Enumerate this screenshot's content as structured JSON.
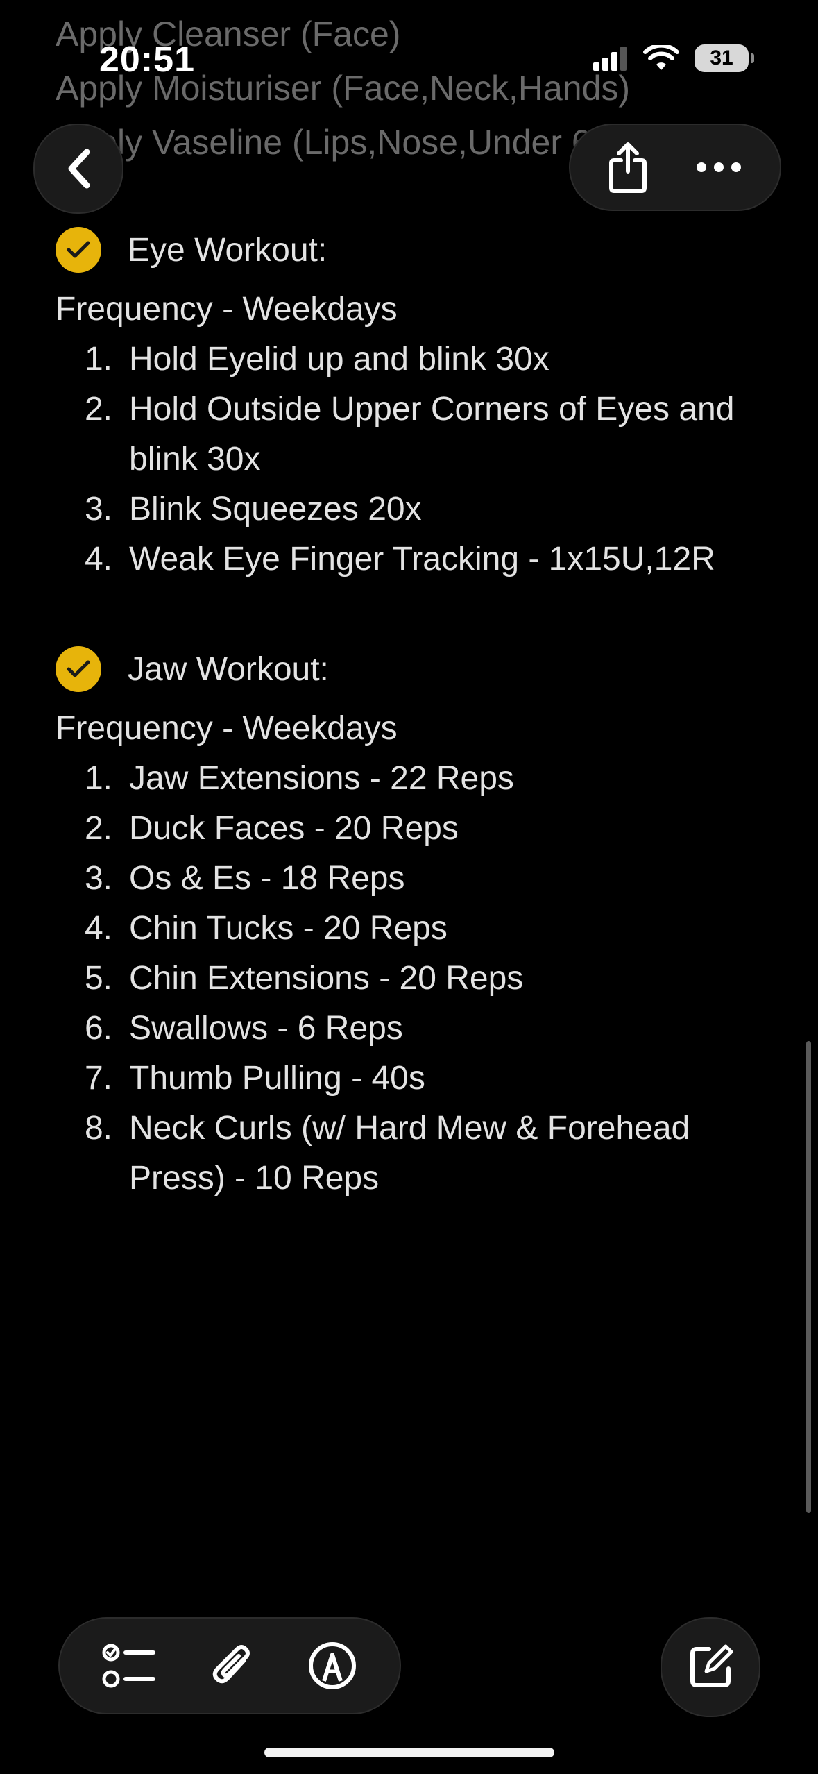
{
  "status_bar": {
    "time": "20:51",
    "battery": "31"
  },
  "faded_lines": [
    "Apply Cleanser (Face)",
    "Apply Moisturiser (Face,Neck,Hands)",
    "Apply Vaseline (Lips,Nose,Under 63)"
  ],
  "sections": [
    {
      "title": "Eye Workout:",
      "frequency": "Frequency - Weekdays",
      "steps": [
        "Hold Eyelid up and blink 30x",
        "Hold Outside Upper Corners of Eyes and blink 30x",
        "Blink Squeezes 20x",
        "Weak Eye Finger Tracking - 1x15U,12R"
      ]
    },
    {
      "title": "Jaw Workout:",
      "frequency": "Frequency - Weekdays",
      "steps": [
        "Jaw Extensions - 22 Reps",
        "Duck Faces - 20 Reps",
        "Os & Es - 18 Reps",
        "Chin Tucks - 20 Reps",
        "Chin Extensions - 20 Reps",
        "Swallows - 6 Reps",
        "Thumb Pulling - 40s",
        "Neck Curls (w/ Hard Mew & Forehead Press) - 10 Reps"
      ]
    }
  ],
  "step_numbers": [
    "1.",
    "2.",
    "3.",
    "4.",
    "5.",
    "6.",
    "7.",
    "8."
  ],
  "icons": {
    "back": "chevron-left-icon",
    "share": "share-icon",
    "more": "ellipsis-icon",
    "checklist": "checklist-icon",
    "attachment": "paperclip-icon",
    "markup": "markup-pen-icon",
    "compose": "compose-icon",
    "section_check": "checkmark-circle-icon"
  },
  "colors": {
    "accent": "#e7b40b",
    "background": "#000000",
    "text": "#e3e3e3"
  }
}
